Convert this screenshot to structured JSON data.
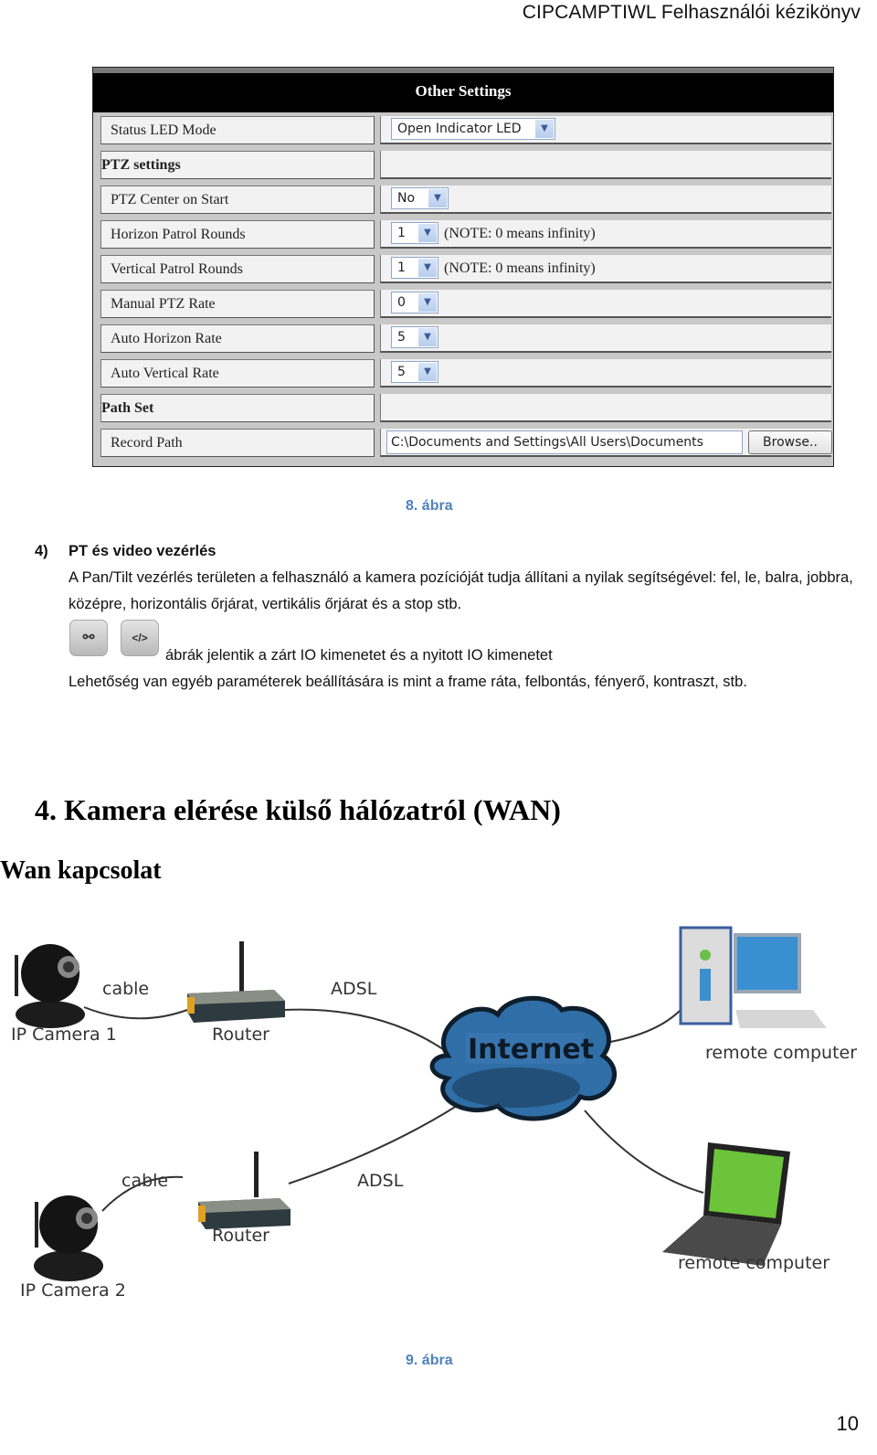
{
  "header": {
    "title": "CIPCAMPTIWL  Felhasználói kézikönyv"
  },
  "settings_panel": {
    "title": "Other Settings",
    "rows": [
      {
        "label": "Status LED Mode",
        "type": "select",
        "value": "Open Indicator LED"
      },
      {
        "label": "PTZ settings",
        "type": "section"
      },
      {
        "label": "PTZ Center on Start",
        "type": "select",
        "value": "No"
      },
      {
        "label": "Horizon Patrol Rounds",
        "type": "select",
        "value": "1",
        "note": "(NOTE: 0 means infinity)"
      },
      {
        "label": "Vertical Patrol Rounds",
        "type": "select",
        "value": "1",
        "note": "(NOTE: 0 means infinity)"
      },
      {
        "label": "Manual PTZ Rate",
        "type": "select",
        "value": "0"
      },
      {
        "label": "Auto Horizon Rate",
        "type": "select",
        "value": "5"
      },
      {
        "label": "Auto Vertical Rate",
        "type": "select",
        "value": "5"
      },
      {
        "label": "Path Set",
        "type": "section"
      },
      {
        "label": "Record Path",
        "type": "path",
        "value": "C:\\Documents and Settings\\All Users\\Documents",
        "button": "Browse.."
      }
    ],
    "dropdown_icon": "chevron-down-icon"
  },
  "figure8_caption": "8. ábra",
  "section4": {
    "number": "4)",
    "title": "PT és video vezérlés",
    "paragraph": "A Pan/Tilt vezérlés területen a felhasználó a kamera pozícióját tudja állítani a nyilak segítségével: fel, le, balra, jobbra, középre, horizontális őrjárat, vertikális őrjárat és a stop stb.",
    "icons": [
      {
        "name": "closed-io-icon",
        "glyph": "⚯"
      },
      {
        "name": "open-io-icon",
        "glyph": "</>"
      }
    ],
    "icons_text": "ábrák jelentik a zárt IO kimenetet és a nyitott IO kimenetet",
    "last_line": "Lehetőség van egyéb paraméterek beállítására is mint a frame ráta, felbontás, fényerő, kontraszt, stb."
  },
  "chapter": {
    "heading": "4. Kamera elérése külső hálózatról (WAN)",
    "subheading": "Wan kapcsolat"
  },
  "diagram": {
    "camera1": "IP Camera 1",
    "camera2": "IP Camera  2",
    "router1": "Router",
    "router2": "Router",
    "cable1": "cable",
    "cable2": "cable",
    "adsl1": "ADSL",
    "adsl2": "ADSL",
    "internet": "Internet",
    "remote1": "remote computer",
    "remote2": "remote computer"
  },
  "figure9_caption": "9. ábra",
  "page_number": "10"
}
